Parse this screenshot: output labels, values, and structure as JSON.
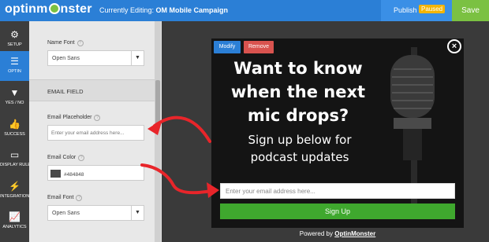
{
  "topbar": {
    "logo_text_1": "optinm",
    "logo_text_2": "nster",
    "editing_prefix": "Currently Editing:",
    "campaign_name": "OM Mobile Campaign",
    "publish_label": "Publish",
    "status_badge": "Paused",
    "save_label": "Save"
  },
  "nav": {
    "items": [
      {
        "label": "SETUP",
        "icon": "gear-icon"
      },
      {
        "label": "OPTIN",
        "icon": "menu-icon"
      },
      {
        "label": "YES / NO",
        "icon": "filter-icon"
      },
      {
        "label": "SUCCESS",
        "icon": "thumbs-up-icon"
      },
      {
        "label": "DISPLAY RULES",
        "icon": "monitor-icon"
      },
      {
        "label": "INTEGRATIONS",
        "icon": "plug-icon"
      },
      {
        "label": "ANALYTICS",
        "icon": "chart-icon"
      }
    ],
    "active": "OPTIN"
  },
  "panel": {
    "name_font_label": "Name Font",
    "name_font_value": "Open Sans",
    "section_title": "EMAIL FIELD",
    "email_placeholder_label": "Email Placeholder",
    "email_placeholder_value": "Enter your email address here...",
    "email_color_label": "Email Color",
    "email_color_value": "#484848",
    "email_font_label": "Email Font",
    "email_font_value": "Open Sans"
  },
  "popup": {
    "modify_label": "Modify",
    "remove_label": "Remove",
    "close_symbol": "×",
    "headline": "Want to know when the next mic drops?",
    "subline": "Sign up below for podcast updates",
    "email_placeholder": "Enter your email address here...",
    "signup_label": "Sign Up",
    "powered_prefix": "Powered by",
    "powered_brand": "OptinMonster"
  },
  "colors": {
    "brand_blue": "#2b7fd6",
    "save_green": "#7bc142",
    "paused_yellow": "#f4b400",
    "remove_red": "#d9534f",
    "signup_green": "#3fa82e",
    "arrow_red": "#e8252a"
  }
}
